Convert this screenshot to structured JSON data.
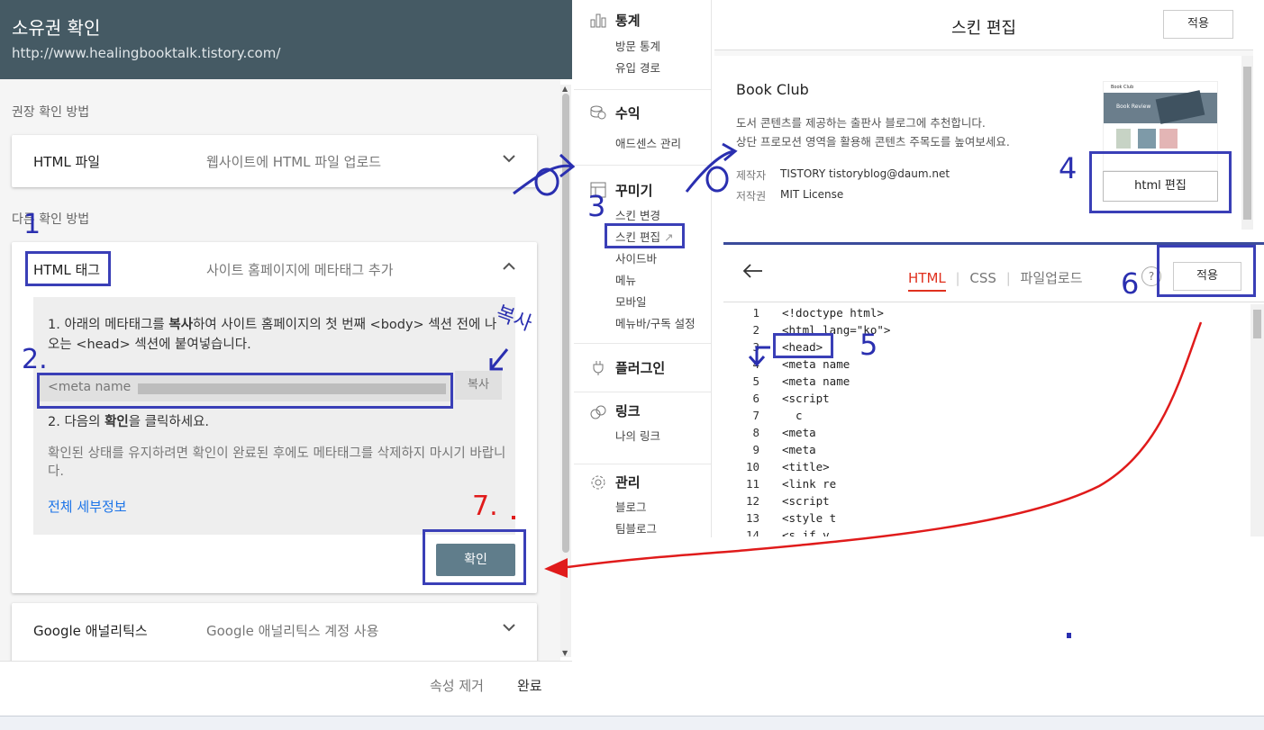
{
  "gsc": {
    "title": "소유권 확인",
    "url": "http://www.healingbooktalk.tistory.com/",
    "recommended_label": "권장 확인 방법",
    "other_label": "다른 확인 방법",
    "html_file": {
      "name": "HTML 파일",
      "desc": "웹사이트에 HTML 파일 업로드"
    },
    "html_tag": {
      "name": "HTML 태그",
      "desc": "사이트 홈페이지에 메타태그 추가",
      "step1_pre": "1. 아래의 메타태그를 ",
      "step1_bold": "복사",
      "step1_post": "하여 사이트 홈페이지의 첫 번째 <body> 섹션 전에 나오는 <head> 섹션에 붙여넣습니다.",
      "meta_value": "<meta name",
      "copy_label": "복사",
      "step2_pre": "2. 다음의 ",
      "step2_bold": "확인",
      "step2_post": "을 클릭하세요.",
      "note": "확인된 상태를 유지하려면 확인이 완료된 후에도 메타태그를 삭제하지 마시기 바랍니다.",
      "details_link": "전체 세부정보",
      "confirm_label": "확인"
    },
    "ga": {
      "name": "Google 애널리틱스",
      "desc": "Google 애널리틱스 계정 사용"
    },
    "footer": {
      "remove_label": "속성 제거",
      "done_label": "완료"
    }
  },
  "tistory_menu": [
    {
      "title": "통계",
      "icon": "bar-chart-icon",
      "items": [
        "방문 통계",
        "유입 경로"
      ]
    },
    {
      "title": "수익",
      "icon": "coins-icon",
      "items": [
        "애드센스 관리"
      ]
    },
    {
      "title": "꾸미기",
      "icon": "layout-icon",
      "items": [
        "스킨 변경",
        "스킨 편집",
        "사이드바",
        "메뉴",
        "모바일",
        "메뉴바/구독 설정"
      ]
    },
    {
      "title": "플러그인",
      "icon": "plug-icon",
      "items": []
    },
    {
      "title": "링크",
      "icon": "link-icon",
      "items": [
        "나의 링크"
      ]
    },
    {
      "title": "관리",
      "icon": "gear-icon",
      "items": [
        "블로그",
        "팀블로그"
      ]
    }
  ],
  "skin": {
    "title": "스킨 편집",
    "apply_label": "적용",
    "name": "Book Club",
    "desc_line1": "도서 콘텐츠를 제공하는 출판사 블로그에 추천합니다.",
    "desc_line2": "상단 프로모션 영역을 활용해 콘텐츠 주목도를 높여보세요.",
    "maker_label": "제작자",
    "maker_value": "TISTORY tistoryblog@daum.net",
    "license_label": "저작권",
    "license_value": "MIT License",
    "html_edit_label": "html 편집",
    "thumb_title": "Book Club",
    "thumb_banner": "Book Review"
  },
  "editor": {
    "tab_html": "HTML",
    "tab_css": "CSS",
    "tab_upload": "파일업로드",
    "help": "?",
    "apply_label": "적용",
    "lines": [
      {
        "n": "1",
        "code": "<!doctype html>"
      },
      {
        "n": "2",
        "code": "<html lang=\"ko\">"
      },
      {
        "n": "3",
        "code": "<head>"
      },
      {
        "n": "4",
        "code": "<meta name"
      },
      {
        "n": "5",
        "code": "<meta name"
      },
      {
        "n": "6",
        "code": "<script"
      },
      {
        "n": "7",
        "code": "  c"
      },
      {
        "n": "8",
        "code": "<meta"
      },
      {
        "n": "9",
        "code": "<meta"
      },
      {
        "n": "10",
        "code": "<title>"
      },
      {
        "n": "11",
        "code": "<link re"
      },
      {
        "n": "12",
        "code": "<script"
      },
      {
        "n": "13",
        "code": "<style t"
      },
      {
        "n": "14",
        "code": "<s if v"
      }
    ]
  },
  "annotations": {
    "n1": "1",
    "n2": "2.",
    "n3": "3",
    "n4": "4",
    "n5": "5",
    "n6": "6",
    "n7": "7.",
    "copy_note": "복사",
    "ann_color": "#2a2fb0",
    "arrow_color": "#e01b1b"
  }
}
